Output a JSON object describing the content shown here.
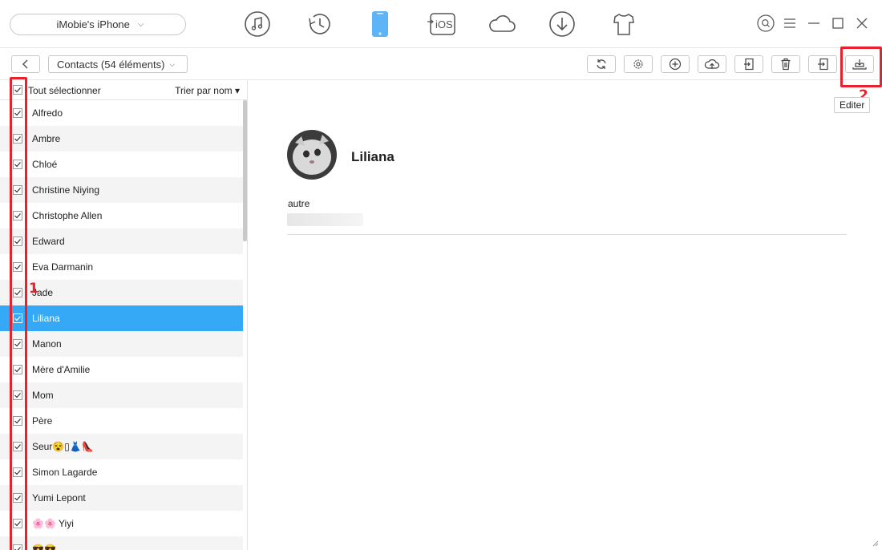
{
  "device": {
    "name": "iMobie's iPhone"
  },
  "nav_icons": [
    "music-icon",
    "history-icon",
    "phone-icon",
    "ios-transfer-icon",
    "cloud-icon",
    "download-icon",
    "tshirt-icon"
  ],
  "nav_ios_label": "iOS",
  "toolbar": {
    "category": "Contacts (54 éléments)",
    "buttons": [
      "refresh-icon",
      "settings-icon",
      "add-icon",
      "upload-cloud-icon",
      "export-icon",
      "delete-icon",
      "import-icon",
      "edit-icon"
    ]
  },
  "tooltip": "Editer",
  "annotations": {
    "step1": "1",
    "step2": "2"
  },
  "list": {
    "select_all_label": "Tout sélectionner",
    "sort_label": "Trier par nom ▾",
    "contacts": [
      {
        "name": "Alfredo"
      },
      {
        "name": "Ambre"
      },
      {
        "name": "Chloé"
      },
      {
        "name": "Christine Niying"
      },
      {
        "name": "Christophe Allen"
      },
      {
        "name": "Edward"
      },
      {
        "name": "Eva Darmanin"
      },
      {
        "name": "Jade"
      },
      {
        "name": "Liliana"
      },
      {
        "name": "Manon"
      },
      {
        "name": "Mère d'Amilie"
      },
      {
        "name": "Mom"
      },
      {
        "name": "Père"
      },
      {
        "name": "Seur😵▯👗👠"
      },
      {
        "name": "Simon Lagarde"
      },
      {
        "name": "Yumi Lepont"
      },
      {
        "name": "🌸🌸 Yiyi"
      },
      {
        "name": "😎😎"
      }
    ],
    "selected_name": "Liliana"
  },
  "detail": {
    "name": "Liliana",
    "field_label": "autre"
  },
  "colors": {
    "accent": "#35a9f5",
    "highlight": "#e5222e"
  }
}
